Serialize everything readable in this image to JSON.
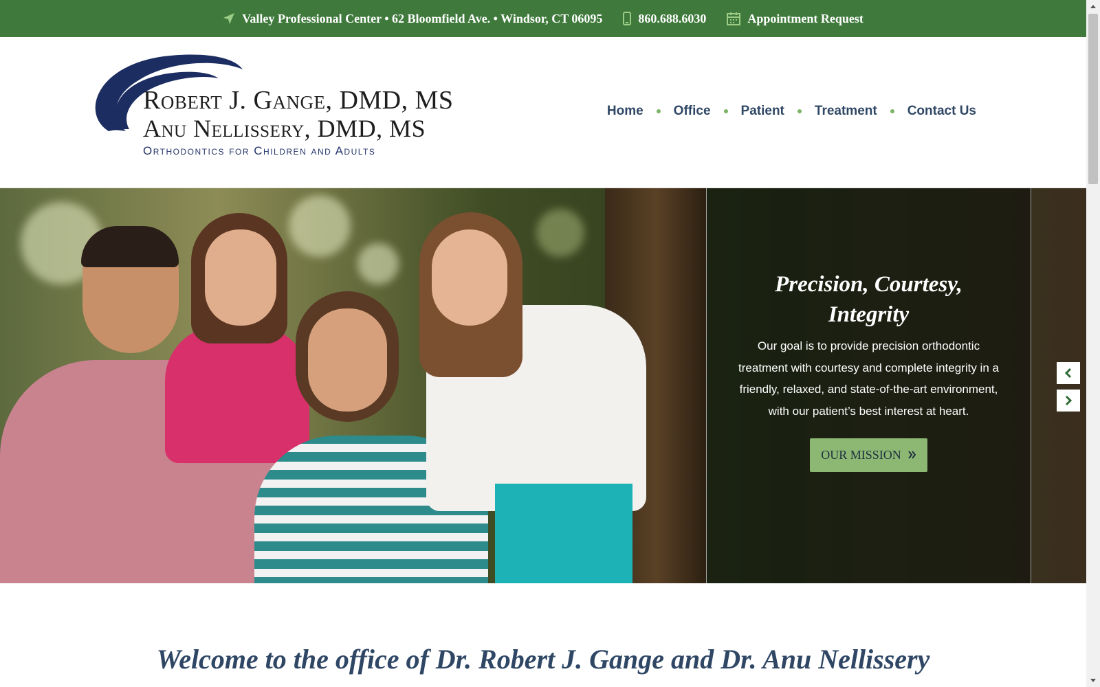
{
  "colors": {
    "topbar_bg": "#3f7a3c",
    "nav_text": "#2f4765",
    "nav_dot": "#7bb466",
    "button_bg": "#8cb873",
    "logo_blue": "#24356a"
  },
  "topbar": {
    "address": "Valley Professional Center • 62 Bloomfield Ave. • Windsor, CT 06095",
    "phone": "860.688.6030",
    "appointment": "Appointment Request",
    "icons": [
      "location-arrow-icon",
      "mobile-phone-icon",
      "calendar-icon"
    ]
  },
  "logo": {
    "line1": "Robert J. Gange, DMD, MS",
    "line2": "Anu Nellissery, DMD, MS",
    "tagline": "Orthodontics for Children and Adults"
  },
  "nav": {
    "items": [
      "Home",
      "Office",
      "Patient",
      "Treatment",
      "Contact Us"
    ]
  },
  "hero": {
    "heading": "Precision, Courtesy, Integrity",
    "body": "Our goal is to provide precision orthodontic treatment with courtesy and complete integrity in a friendly, relaxed, and state-of-the-art environment, with our patient’s best interest at heart.",
    "button": "Our Mission",
    "prev_icon": "chevron-left-icon",
    "next_icon": "chevron-right-icon"
  },
  "welcome": {
    "title": "Welcome to the office of Dr. Robert J. Gange and Dr. Anu Nellissery"
  }
}
